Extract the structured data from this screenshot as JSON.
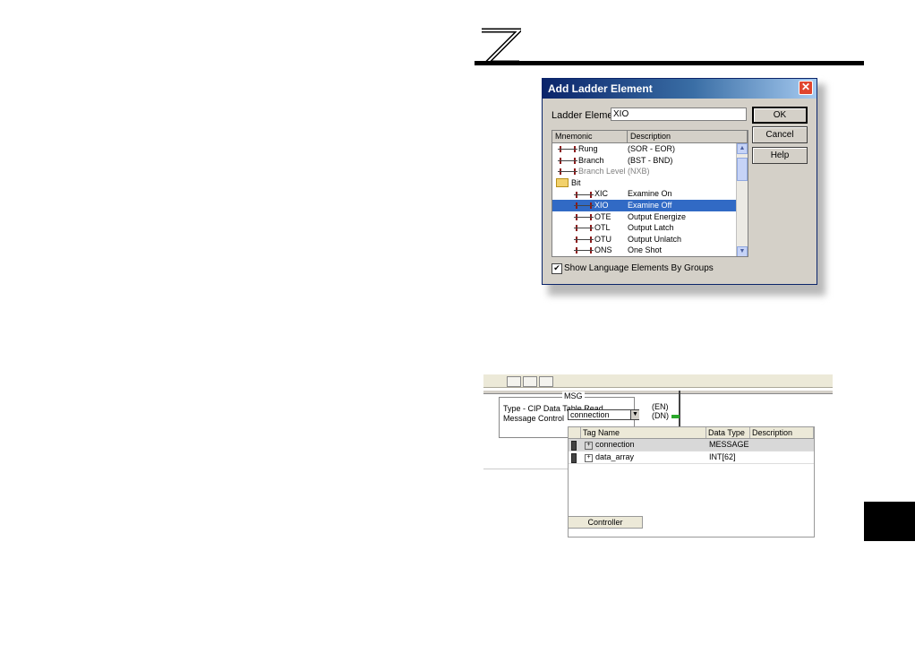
{
  "dialog": {
    "title": "Add Ladder Element",
    "close_glyph": "✕",
    "ladder_element_label": "Ladder Element:",
    "ladder_element_value": "XIO",
    "ok_label": "OK",
    "cancel_label": "Cancel",
    "help_label": "Help",
    "columns": [
      "Mnemonic",
      "Description"
    ],
    "rows": [
      {
        "mnemonic": "Rung",
        "description": "(SOR - EOR)",
        "icon": "ladder-element-icon"
      },
      {
        "mnemonic": "Branch",
        "description": "(BST - BND)",
        "icon": "ladder-element-icon"
      },
      {
        "mnemonic": "Branch Level",
        "description": "(NXB)",
        "icon": "ladder-element-icon"
      },
      {
        "mnemonic": "Bit",
        "description": "",
        "icon": "folder-icon"
      },
      {
        "mnemonic": "XIC",
        "description": "Examine On",
        "icon": "ladder-element-icon"
      },
      {
        "mnemonic": "XIO",
        "description": "Examine Off",
        "icon": "ladder-element-icon"
      },
      {
        "mnemonic": "OTE",
        "description": "Output Energize",
        "icon": "ladder-element-icon"
      },
      {
        "mnemonic": "OTL",
        "description": "Output Latch",
        "icon": "ladder-element-icon"
      },
      {
        "mnemonic": "OTU",
        "description": "Output Unlatch",
        "icon": "ladder-element-icon"
      },
      {
        "mnemonic": "ONS",
        "description": "One Shot",
        "icon": "ladder-element-icon"
      }
    ],
    "selected_row": "XIO",
    "show_groups_checked": true,
    "show_groups_label": "Show Language Elements By Groups"
  },
  "ladder": {
    "msg_title": "MSG",
    "msg_type": "Type - CIP Data Table Read",
    "msg_control_label": "Message Control",
    "msg_control_value": "connection",
    "en_label": "(EN)",
    "dn_label": "(DN)",
    "tag_columns": [
      "Tag Name",
      "Data Type",
      "Description"
    ],
    "tags": [
      {
        "name": "connection",
        "type": "MESSAGE",
        "description": ""
      },
      {
        "name": "data_array",
        "type": "INT[62]",
        "description": ""
      }
    ],
    "scope_tab": "Controller"
  },
  "colors": {
    "selection": "#316ac5",
    "title_gradient_start": "#0a246a",
    "dialog_face": "#d4d0c8",
    "dn_indicator": "#2aa82a"
  }
}
